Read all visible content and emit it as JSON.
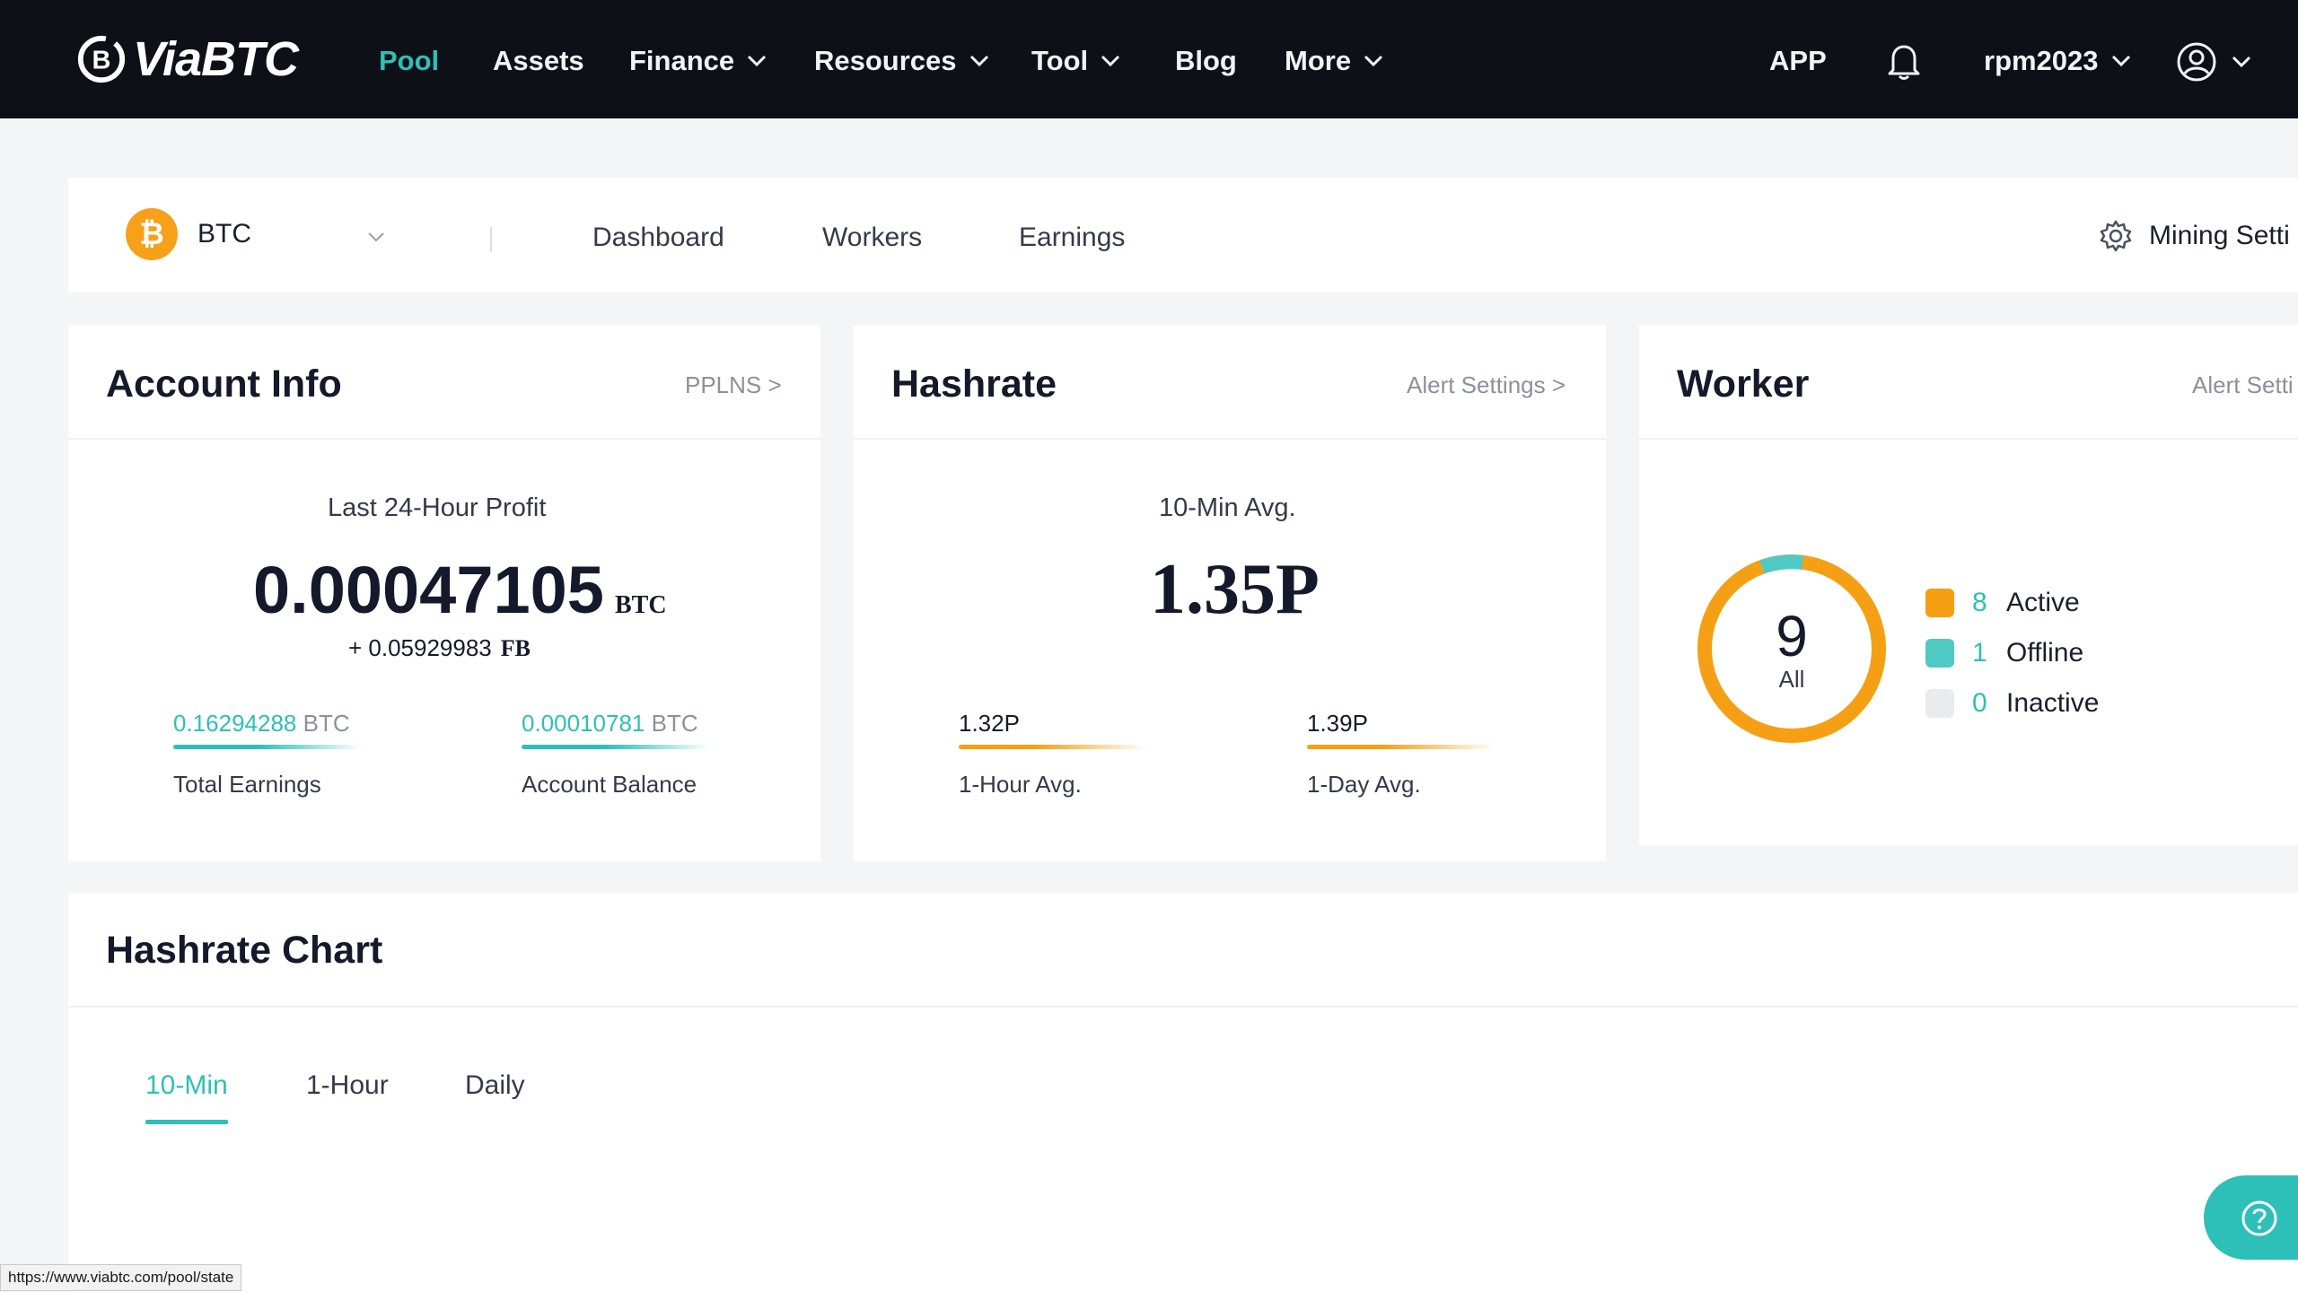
{
  "brand": {
    "name": "ViaBTC",
    "accent": "#2dc0b8",
    "nav_bg": "#0d1017"
  },
  "nav": {
    "items": [
      {
        "label": "Pool",
        "active": true
      },
      {
        "label": "Assets"
      },
      {
        "label": "Finance",
        "dropdown": true
      },
      {
        "label": "Resources",
        "dropdown": true
      },
      {
        "label": "Tool",
        "dropdown": true
      },
      {
        "label": "Blog"
      },
      {
        "label": "More",
        "dropdown": true
      }
    ],
    "app_label": "APP",
    "username": "rpm2023",
    "icons": [
      "bell-icon",
      "user-circle-icon",
      "chevron-down-icon"
    ]
  },
  "subnav": {
    "coin": "BTC",
    "tabs": [
      "Dashboard",
      "Workers",
      "Earnings"
    ],
    "mining_settings": "Mining Setti"
  },
  "account": {
    "title": "Account Info",
    "link": "PPLNS >",
    "profit_label": "Last 24-Hour Profit",
    "profit_value": "0.00047105",
    "profit_unit": "BTC",
    "extra": "+ 0.05929983",
    "extra_unit": "FB",
    "total_value": "0.16294288",
    "total_unit": "BTC",
    "total_label": "Total Earnings",
    "balance_value": "0.00010781",
    "balance_unit": "BTC",
    "balance_label": "Account Balance"
  },
  "hashrate": {
    "title": "Hashrate",
    "link": "Alert Settings >",
    "avg10_label": "10-Min Avg.",
    "avg10_value": "1.35P",
    "h1_value": "1.32P",
    "h1_label": "1-Hour Avg.",
    "d1_value": "1.39P",
    "d1_label": "1-Day Avg."
  },
  "worker": {
    "title": "Worker",
    "link": "Alert Setti",
    "total": "9",
    "total_label": "All",
    "legend": [
      {
        "count": "8",
        "label": "Active",
        "color": "#f5a014"
      },
      {
        "count": "1",
        "label": "Offline",
        "color": "#4fc9c4"
      },
      {
        "count": "0",
        "label": "Inactive",
        "color": "#e9ebee"
      }
    ]
  },
  "hashrate_chart": {
    "title": "Hashrate Chart",
    "tabs": [
      "10-Min",
      "1-Hour",
      "Daily"
    ],
    "active_tab": "10-Min"
  },
  "status_url": "https://www.viabtc.com/pool/state"
}
